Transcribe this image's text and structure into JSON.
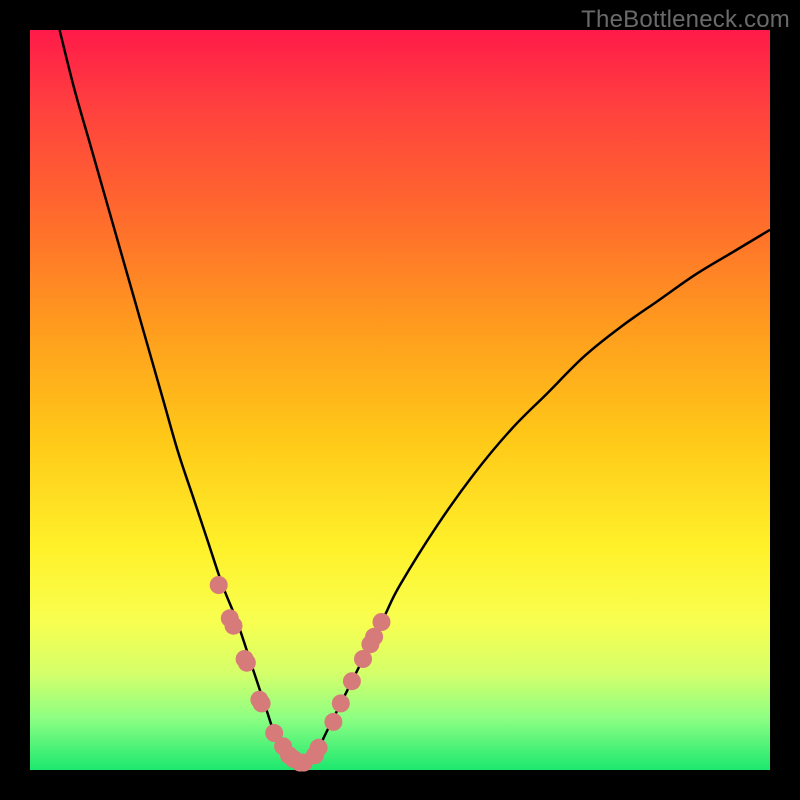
{
  "watermark": "TheBottleneck.com",
  "colors": {
    "curve_stroke": "#000000",
    "marker_fill": "#d77a7a",
    "frame_bg": "#000000"
  },
  "chart_data": {
    "type": "line",
    "title": "",
    "xlabel": "",
    "ylabel": "",
    "xlim": [
      0,
      100
    ],
    "ylim": [
      0,
      100
    ],
    "grid": false,
    "series": [
      {
        "name": "bottleneck-curve",
        "x": [
          4,
          6,
          8,
          10,
          12,
          14,
          16,
          18,
          20,
          22,
          24,
          26,
          28,
          30,
          31,
          32,
          33,
          34,
          35,
          36,
          37,
          38,
          39,
          40,
          42,
          44,
          46,
          48,
          50,
          55,
          60,
          65,
          70,
          75,
          80,
          85,
          90,
          95,
          100
        ],
        "y": [
          100,
          92,
          85,
          78,
          71,
          64,
          57,
          50,
          43,
          37,
          31,
          25,
          20,
          14,
          11,
          8,
          5,
          3,
          2,
          1,
          1,
          2,
          3,
          5,
          9,
          13,
          17,
          21,
          25,
          33,
          40,
          46,
          51,
          56,
          60,
          63.5,
          67,
          70,
          73
        ]
      }
    ],
    "markers": {
      "name": "highlighted-points",
      "x": [
        25.5,
        27,
        27.5,
        29,
        29.3,
        31,
        31.3,
        33,
        34.2,
        35,
        35.6,
        36.5,
        37,
        38.5,
        39,
        41,
        42,
        43.5,
        45,
        46,
        46.5,
        47.5
      ],
      "y": [
        25,
        20.5,
        19.5,
        15,
        14.5,
        9.5,
        9,
        5,
        3.2,
        2,
        1.5,
        1,
        1,
        2,
        3,
        6.5,
        9,
        12,
        15,
        17,
        18,
        20
      ]
    }
  }
}
